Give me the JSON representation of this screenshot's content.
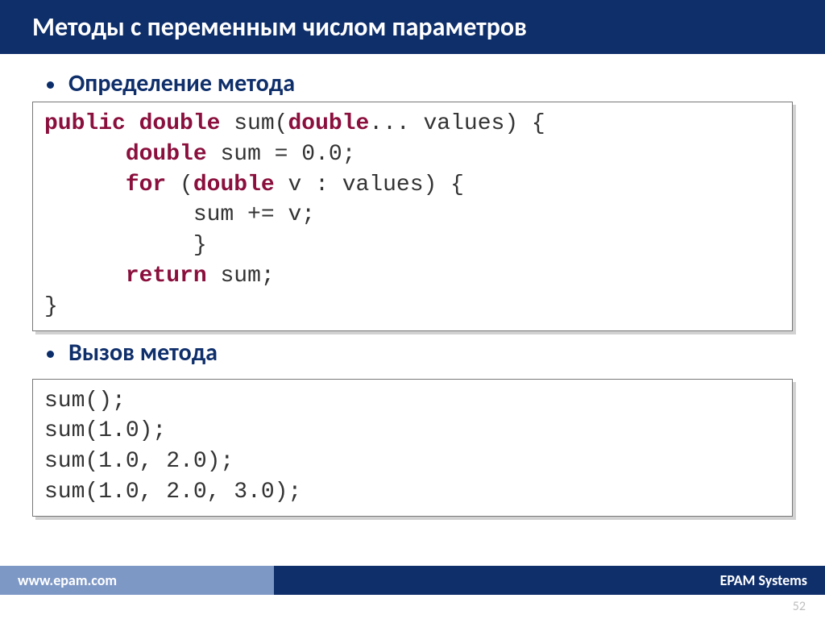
{
  "title": "Методы с переменным числом параметров",
  "bullets": {
    "definition": "Определение метода",
    "call": "Вызов метода"
  },
  "code1": {
    "line1_pre": "public double ",
    "line1_mid": "sum(",
    "line1_kw2": "double",
    "line1_post": "... values) {",
    "line2_indent": "      ",
    "line2_kw": "double",
    "line2_rest": " sum = 0.0;",
    "line3_indent": "      ",
    "line3_kw": "for",
    "line3_mid": " (",
    "line3_kw2": "double",
    "line3_rest": " v : values) {",
    "line4": "           sum += v;",
    "line5": "           }",
    "line6_indent": "      ",
    "line6_kw": "return",
    "line6_rest": " sum;",
    "line7": "}"
  },
  "code2": "sum();\nsum(1.0);\nsum(1.0, 2.0);\nsum(1.0, 2.0, 3.0);",
  "footer": {
    "left": "www.epam.com",
    "right": "EPAM Systems"
  },
  "page": "52"
}
